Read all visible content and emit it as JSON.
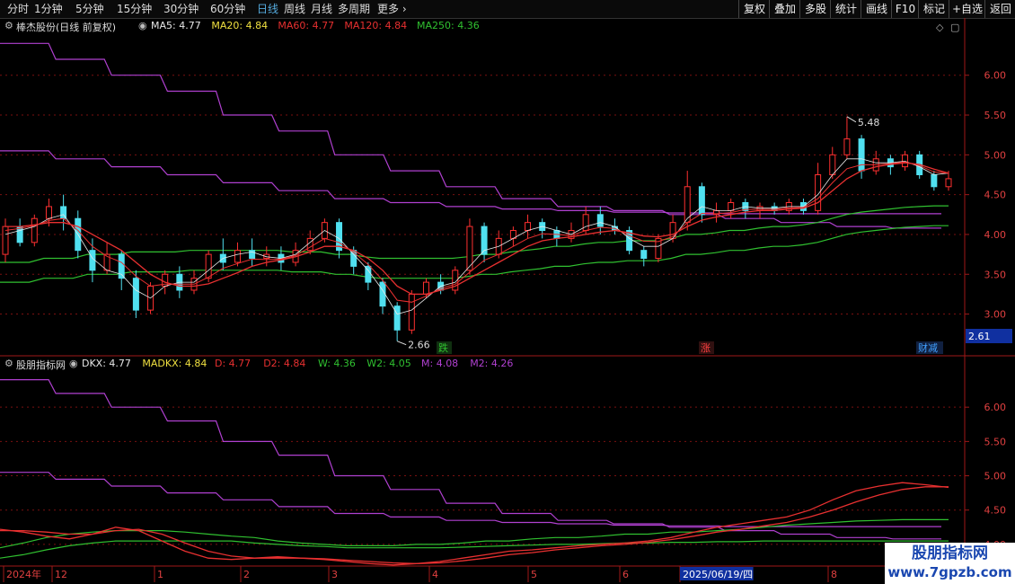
{
  "toolbar": {
    "periods": [
      "分时",
      "1分钟",
      "5分钟",
      "15分钟",
      "30分钟",
      "60分钟",
      "日线",
      "周线",
      "月线",
      "多周期",
      "更多"
    ],
    "active_period": "日线",
    "right_buttons": [
      "复权",
      "叠加",
      "多股",
      "统计",
      "画线",
      "F10",
      "标记",
      "+自选",
      "返回"
    ]
  },
  "main_panel": {
    "title": "棒杰股份(日线 前复权)",
    "indicators": [
      {
        "label": "MA5: 4.77",
        "color": "#e8e8e8"
      },
      {
        "label": "MA20: 4.84",
        "color": "#f0e040"
      },
      {
        "label": "MA60: 4.77",
        "color": "#e83030"
      },
      {
        "label": "MA120: 4.84",
        "color": "#e83030"
      },
      {
        "label": "MA250: 4.36",
        "color": "#30c030"
      }
    ],
    "price_high_label": "5.48",
    "price_low_label": "2.66",
    "current_value_box": "2.61",
    "event_markers": [
      {
        "text": "跌",
        "color": "#30c030",
        "bg": "#103010"
      },
      {
        "text": "涨",
        "color": "#ff4040",
        "bg": "#301010"
      },
      {
        "text": "财减",
        "color": "#40a0ff",
        "bg": "#102040"
      }
    ]
  },
  "sub_panel": {
    "title": "股朋指标网",
    "indicators": [
      {
        "label": "DKX: 4.77",
        "color": "#e8e8e8"
      },
      {
        "label": "MADKX: 4.84",
        "color": "#f0e040"
      },
      {
        "label": "D: 4.77",
        "color": "#e83030"
      },
      {
        "label": "D2: 4.84",
        "color": "#e83030"
      },
      {
        "label": "W: 4.36",
        "color": "#30c030"
      },
      {
        "label": "W2: 4.05",
        "color": "#30c030"
      },
      {
        "label": "M: 4.08",
        "color": "#b040d0"
      },
      {
        "label": "M2: 4.26",
        "color": "#b040d0"
      }
    ]
  },
  "x_axis": {
    "labels": [
      "2024年",
      "12",
      "1",
      "2",
      "3",
      "4",
      "5",
      "6",
      "2025/06/19/四",
      "8"
    ]
  },
  "watermark": {
    "line1": "股朋指标网",
    "line2": "www.7gpzb.com"
  },
  "colors": {
    "up": "#ff3030",
    "down": "#50e0f0",
    "grid": "#7a1010",
    "axis": "#a01818"
  },
  "chart_data": [
    {
      "type": "candlestick",
      "title": "棒杰股份(日线 前复权)",
      "ylim": [
        2.6,
        6.55
      ],
      "yticks": [
        3.0,
        3.5,
        4.0,
        4.5,
        5.0,
        5.5,
        6.0
      ],
      "candles_sampled": [
        [
          3.75,
          4.1,
          4.2,
          3.65
        ],
        [
          4.1,
          3.9,
          4.2,
          3.85
        ],
        [
          3.9,
          4.2,
          4.25,
          3.85
        ],
        [
          4.2,
          4.35,
          4.45,
          4.1
        ],
        [
          4.35,
          4.2,
          4.5,
          4.05
        ],
        [
          4.2,
          3.8,
          4.3,
          3.7
        ],
        [
          3.8,
          3.55,
          3.95,
          3.4
        ],
        [
          3.55,
          3.75,
          3.9,
          3.5
        ],
        [
          3.75,
          3.45,
          3.8,
          3.3
        ],
        [
          3.45,
          3.05,
          3.55,
          2.95
        ],
        [
          3.05,
          3.35,
          3.4,
          3.0
        ],
        [
          3.35,
          3.5,
          3.55,
          3.25
        ],
        [
          3.5,
          3.3,
          3.6,
          3.2
        ],
        [
          3.3,
          3.45,
          3.55,
          3.25
        ],
        [
          3.45,
          3.75,
          3.8,
          3.4
        ],
        [
          3.75,
          3.65,
          3.95,
          3.55
        ],
        [
          3.65,
          3.8,
          3.9,
          3.6
        ],
        [
          3.8,
          3.7,
          3.95,
          3.6
        ],
        [
          3.7,
          3.75,
          3.85,
          3.6
        ],
        [
          3.75,
          3.65,
          3.85,
          3.55
        ],
        [
          3.65,
          3.8,
          3.9,
          3.6
        ],
        [
          3.8,
          3.95,
          4.05,
          3.75
        ],
        [
          3.95,
          4.15,
          4.2,
          3.9
        ],
        [
          4.15,
          3.8,
          4.2,
          3.7
        ],
        [
          3.8,
          3.6,
          3.85,
          3.5
        ],
        [
          3.6,
          3.4,
          3.65,
          3.3
        ],
        [
          3.4,
          3.1,
          3.45,
          3.0
        ],
        [
          3.1,
          2.8,
          3.15,
          2.66
        ],
        [
          2.8,
          3.25,
          3.3,
          2.75
        ],
        [
          3.25,
          3.4,
          3.45,
          3.2
        ],
        [
          3.4,
          3.3,
          3.5,
          3.25
        ],
        [
          3.3,
          3.55,
          3.6,
          3.25
        ],
        [
          3.55,
          4.1,
          4.2,
          3.5
        ],
        [
          4.1,
          3.75,
          4.15,
          3.65
        ],
        [
          3.75,
          3.95,
          4.05,
          3.7
        ],
        [
          3.95,
          4.05,
          4.1,
          3.85
        ],
        [
          4.05,
          4.15,
          4.25,
          3.95
        ],
        [
          4.15,
          4.05,
          4.2,
          3.95
        ],
        [
          4.05,
          3.95,
          4.1,
          3.85
        ],
        [
          3.95,
          4.05,
          4.15,
          3.9
        ],
        [
          4.05,
          4.25,
          4.35,
          4.0
        ],
        [
          4.25,
          4.1,
          4.35,
          4.0
        ],
        [
          4.1,
          4.05,
          4.2,
          4.0
        ],
        [
          4.05,
          3.8,
          4.1,
          3.75
        ],
        [
          3.8,
          3.7,
          3.85,
          3.6
        ],
        [
          3.7,
          3.95,
          4.0,
          3.65
        ],
        [
          3.95,
          4.15,
          4.25,
          3.9
        ],
        [
          4.15,
          4.6,
          4.8,
          4.05
        ],
        [
          4.6,
          4.25,
          4.65,
          4.15
        ],
        [
          4.25,
          4.3,
          4.4,
          4.15
        ],
        [
          4.3,
          4.4,
          4.45,
          4.2
        ],
        [
          4.4,
          4.3,
          4.45,
          4.2
        ],
        [
          4.3,
          4.35,
          4.4,
          4.2
        ],
        [
          4.35,
          4.3,
          4.4,
          4.25
        ],
        [
          4.3,
          4.4,
          4.45,
          4.25
        ],
        [
          4.4,
          4.3,
          4.45,
          4.25
        ],
        [
          4.3,
          4.75,
          4.9,
          4.25
        ],
        [
          4.75,
          5.0,
          5.1,
          4.7
        ],
        [
          5.0,
          5.2,
          5.48,
          4.95
        ],
        [
          5.2,
          4.8,
          5.25,
          4.7
        ],
        [
          4.8,
          4.95,
          5.05,
          4.75
        ],
        [
          4.95,
          4.85,
          5.0,
          4.75
        ],
        [
          4.85,
          5.0,
          5.05,
          4.8
        ],
        [
          5.0,
          4.75,
          5.05,
          4.7
        ],
        [
          4.75,
          4.6,
          4.8,
          4.55
        ],
        [
          4.6,
          4.7,
          4.8,
          4.55
        ]
      ],
      "ma_series": [
        {
          "name": "MA5",
          "values": [
            4.0,
            4.05,
            4.1,
            4.2,
            4.25,
            4.0,
            3.7,
            3.55,
            3.5,
            3.3,
            3.2,
            3.35,
            3.4,
            3.4,
            3.55,
            3.7,
            3.75,
            3.78,
            3.72,
            3.7,
            3.75,
            3.9,
            4.05,
            3.95,
            3.75,
            3.55,
            3.3,
            3.0,
            3.05,
            3.2,
            3.35,
            3.4,
            3.6,
            3.8,
            3.85,
            3.95,
            4.05,
            4.1,
            4.05,
            4.0,
            4.1,
            4.15,
            4.1,
            3.95,
            3.85,
            3.85,
            3.95,
            4.2,
            4.35,
            4.3,
            4.3,
            4.35,
            4.33,
            4.33,
            4.35,
            4.35,
            4.5,
            4.75,
            4.95,
            4.95,
            4.9,
            4.9,
            4.92,
            4.85,
            4.75,
            4.77
          ]
        },
        {
          "name": "MA60",
          "values": [
            4.1,
            4.1,
            4.12,
            4.15,
            4.15,
            4.1,
            4.0,
            3.9,
            3.8,
            3.65,
            3.5,
            3.4,
            3.35,
            3.35,
            3.38,
            3.45,
            3.52,
            3.6,
            3.65,
            3.68,
            3.72,
            3.78,
            3.85,
            3.85,
            3.8,
            3.7,
            3.55,
            3.35,
            3.25,
            3.25,
            3.3,
            3.35,
            3.45,
            3.55,
            3.65,
            3.75,
            3.85,
            3.92,
            3.95,
            3.97,
            4.0,
            4.03,
            4.05,
            4.02,
            3.98,
            3.97,
            4.0,
            4.1,
            4.18,
            4.22,
            4.25,
            4.28,
            4.3,
            4.3,
            4.32,
            4.33,
            4.4,
            4.55,
            4.7,
            4.8,
            4.85,
            4.88,
            4.9,
            4.88,
            4.82,
            4.77
          ]
        },
        {
          "name": "MA250",
          "values": [
            3.65,
            3.65,
            3.65,
            3.7,
            3.7,
            3.7,
            3.75,
            3.75,
            3.75,
            3.78,
            3.78,
            3.78,
            3.78,
            3.8,
            3.8,
            3.8,
            3.8,
            3.8,
            3.8,
            3.8,
            3.78,
            3.78,
            3.78,
            3.75,
            3.75,
            3.72,
            3.7,
            3.7,
            3.7,
            3.7,
            3.7,
            3.7,
            3.72,
            3.75,
            3.75,
            3.78,
            3.8,
            3.82,
            3.85,
            3.85,
            3.88,
            3.9,
            3.9,
            3.92,
            3.92,
            3.92,
            3.95,
            4.0,
            4.0,
            4.02,
            4.05,
            4.05,
            4.08,
            4.1,
            4.1,
            4.12,
            4.15,
            4.2,
            4.25,
            4.28,
            4.3,
            4.32,
            4.34,
            4.35,
            4.36,
            4.36
          ]
        }
      ],
      "m_steps": [
        6.4,
        6.2,
        6.0,
        5.8,
        5.5,
        5.3,
        5.0,
        4.8,
        4.6,
        4.45,
        4.35,
        4.3,
        4.25,
        4.2,
        4.15,
        4.1,
        4.08
      ],
      "m2_steps": [
        5.05,
        4.95,
        4.85,
        4.75,
        4.65,
        4.55,
        4.45,
        4.4,
        4.35,
        4.32,
        4.3,
        4.28,
        4.27,
        4.26,
        4.26,
        4.26,
        4.26
      ]
    },
    {
      "type": "line",
      "title": "股朋指标网",
      "ylim": [
        3.75,
        6.5
      ],
      "yticks": [
        4.0,
        4.5,
        5.0,
        5.5,
        6.0
      ],
      "series": [
        {
          "name": "D",
          "values": [
            4.22,
            4.18,
            4.12,
            4.08,
            4.15,
            4.25,
            4.2,
            4.05,
            3.9,
            3.8,
            3.78,
            3.8,
            3.82,
            3.8,
            3.78,
            3.75,
            3.72,
            3.7,
            3.72,
            3.75,
            3.8,
            3.85,
            3.9,
            3.92,
            3.95,
            3.98,
            4.0,
            4.02,
            4.05,
            4.1,
            4.18,
            4.25,
            4.3,
            4.35,
            4.4,
            4.5,
            4.65,
            4.78,
            4.85,
            4.9,
            4.87,
            4.83
          ]
        },
        {
          "name": "D2",
          "values": [
            4.2,
            4.2,
            4.18,
            4.15,
            4.15,
            4.2,
            4.22,
            4.15,
            4.02,
            3.9,
            3.83,
            3.8,
            3.8,
            3.8,
            3.79,
            3.77,
            3.75,
            3.73,
            3.72,
            3.73,
            3.76,
            3.8,
            3.85,
            3.88,
            3.92,
            3.95,
            3.98,
            4.0,
            4.03,
            4.07,
            4.12,
            4.18,
            4.22,
            4.27,
            4.32,
            4.4,
            4.5,
            4.62,
            4.72,
            4.8,
            4.84,
            4.84
          ]
        },
        {
          "name": "W",
          "values": [
            3.95,
            4.02,
            4.1,
            4.15,
            4.18,
            4.2,
            4.2,
            4.2,
            4.18,
            4.15,
            4.12,
            4.1,
            4.05,
            4.02,
            4.0,
            3.98,
            3.98,
            3.98,
            4.0,
            4.0,
            4.02,
            4.05,
            4.05,
            4.08,
            4.1,
            4.1,
            4.12,
            4.15,
            4.15,
            4.18,
            4.18,
            4.2,
            4.22,
            4.25,
            4.28,
            4.3,
            4.32,
            4.34,
            4.35,
            4.36,
            4.36,
            4.36
          ]
        },
        {
          "name": "W2",
          "values": [
            3.8,
            3.85,
            3.92,
            3.98,
            4.02,
            4.05,
            4.05,
            4.05,
            4.05,
            4.05,
            4.05,
            4.02,
            4.0,
            3.98,
            3.97,
            3.95,
            3.95,
            3.95,
            3.95,
            3.95,
            3.96,
            3.97,
            3.98,
            3.99,
            4.0,
            4.0,
            4.01,
            4.02,
            4.02,
            4.03,
            4.03,
            4.04,
            4.04,
            4.05,
            4.05,
            4.05,
            4.05,
            4.05,
            4.05,
            4.05,
            4.05,
            4.05
          ]
        }
      ]
    }
  ]
}
